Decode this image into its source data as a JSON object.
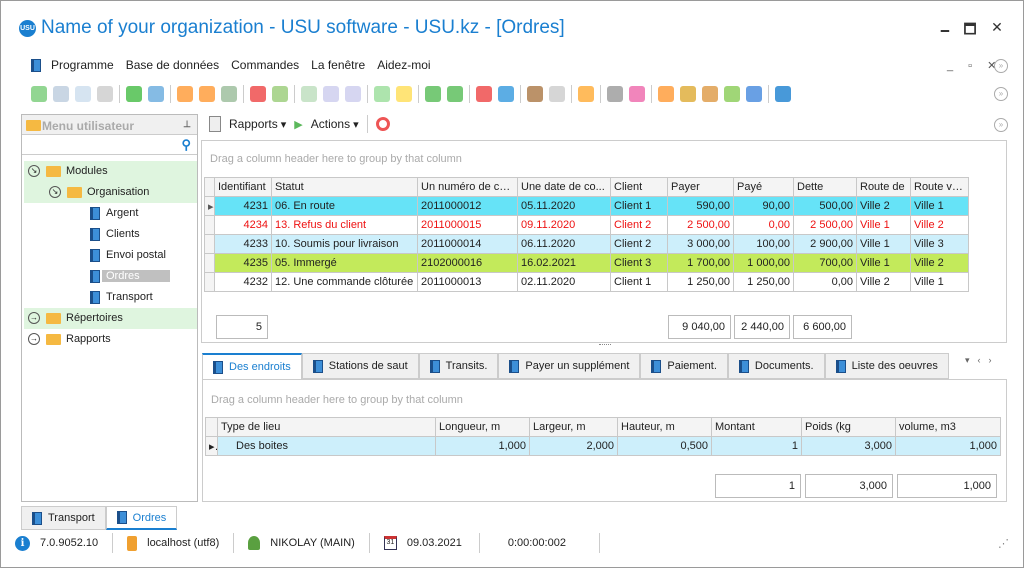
{
  "window": {
    "title": "Name of your organization - USU software - USU.kz - [Ordres]",
    "logo": "USU",
    "minimize": "🗕",
    "maximize": "🗖",
    "close": "✕"
  },
  "menu": [
    "Programme",
    "Base de données",
    "Commandes",
    "La fenêtre",
    "Aidez-moi"
  ],
  "sidebar": {
    "title": "Menu utilisateur",
    "pin": "📌",
    "tree": [
      {
        "label": "Modules",
        "level": 0,
        "type": "folder",
        "green": true,
        "exp": true
      },
      {
        "label": "Organisation",
        "level": 1,
        "type": "folder",
        "green": true,
        "exp": true
      },
      {
        "label": "Argent",
        "level": 2,
        "type": "book"
      },
      {
        "label": "Clients",
        "level": 2,
        "type": "book"
      },
      {
        "label": "Envoi postal",
        "level": 2,
        "type": "book"
      },
      {
        "label": "Ordres",
        "level": 2,
        "type": "book",
        "selected": true
      },
      {
        "label": "Transport",
        "level": 2,
        "type": "book"
      },
      {
        "label": "Répertoires",
        "level": 0,
        "type": "folder",
        "green": true
      },
      {
        "label": "Rapports",
        "level": 0,
        "type": "folder"
      }
    ]
  },
  "subtoolbar": {
    "reports": "Rapports",
    "actions": "Actions"
  },
  "orders": {
    "group_hint": "Drag a column header here to group by that column",
    "columns": [
      "Identifiant",
      "Statut",
      "Un numéro de co...",
      "Une date de co...",
      "Client",
      "Payer",
      "Payé",
      "Dette",
      "Route de",
      "Route vers"
    ],
    "rows": [
      {
        "cells": [
          "4231",
          "06. En route",
          "2011000012",
          "05.11.2020",
          "Client 1",
          "590,00",
          "90,00",
          "500,00",
          "Ville 2",
          "Ville 1"
        ],
        "bg": "#66e3f7",
        "color": "#222",
        "current": true
      },
      {
        "cells": [
          "4234",
          "13. Refus du client",
          "2011000015",
          "09.11.2020",
          "Client 2",
          "2 500,00",
          "0,00",
          "2 500,00",
          "Ville 1",
          "Ville 2"
        ],
        "bg": "#ffffff",
        "color": "#ee1111"
      },
      {
        "cells": [
          "4233",
          "10. Soumis pour livraison",
          "2011000014",
          "06.11.2020",
          "Client 2",
          "3 000,00",
          "100,00",
          "2 900,00",
          "Ville 1",
          "Ville 3"
        ],
        "bg": "#cdeffb",
        "color": "#222"
      },
      {
        "cells": [
          "4235",
          "05. Immergé",
          "2102000016",
          "16.02.2021",
          "Client 3",
          "1 700,00",
          "1 000,00",
          "700,00",
          "Ville 1",
          "Ville 2"
        ],
        "bg": "#c3ea5b",
        "color": "#222"
      },
      {
        "cells": [
          "4232",
          "12. Une commande clôturée",
          "2011000013",
          "02.11.2020",
          "Client 1",
          "1 250,00",
          "1 250,00",
          "0,00",
          "Ville 2",
          "Ville 1"
        ],
        "bg": "#ffffff",
        "color": "#222"
      }
    ],
    "footer": {
      "count": "5",
      "payer": "9 040,00",
      "paye": "2 440,00",
      "dette": "6 600,00"
    }
  },
  "detail_tabs": [
    "Des endroits",
    "Stations de saut",
    "Transits.",
    "Payer un supplément",
    "Paiement.",
    "Documents.",
    "Liste des oeuvres"
  ],
  "places": {
    "group_hint": "Drag a column header here to group by that column",
    "columns": [
      "Type de lieu",
      "Longueur, m",
      "Largeur, m",
      "Hauteur, m",
      "Montant",
      "Poids (kg",
      "volume, m3"
    ],
    "rows": [
      [
        "Des boites",
        "1,000",
        "2,000",
        "0,500",
        "1",
        "3,000",
        "1,000"
      ]
    ],
    "footer": {
      "montant": "1",
      "poids": "3,000",
      "volume": "1,000"
    }
  },
  "bottom_tabs": [
    "Transport",
    "Ordres"
  ],
  "status": {
    "version": "7.0.9052.10",
    "server": "localhost (utf8)",
    "user": "NIKOLAY (MAIN)",
    "date": "09.03.2021",
    "timer": "0:00:00:002"
  }
}
